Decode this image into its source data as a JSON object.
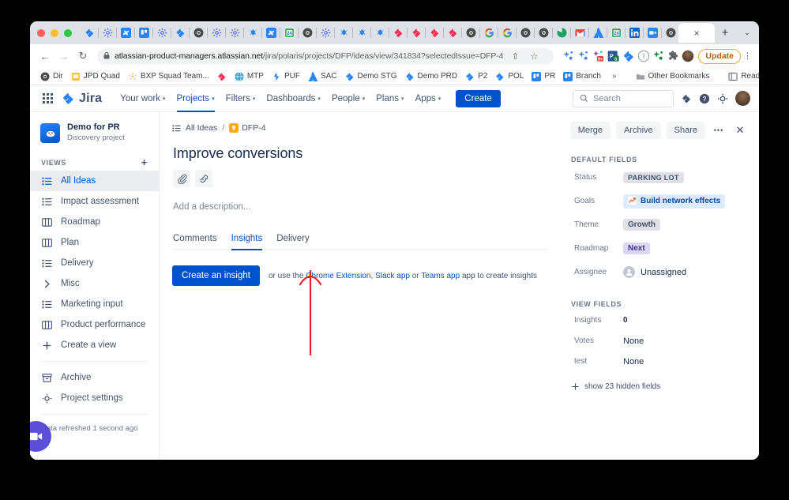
{
  "browser": {
    "tab_icons": [
      "jira-icon",
      "settings-icon",
      "confluence-icon",
      "trello-icon",
      "settings-icon",
      "jira-icon",
      "chrome-icon",
      "settings-icon",
      "settings-icon",
      "bitbucket-icon",
      "confluence-icon",
      "calendar-icon",
      "chrome-dark-icon",
      "settings-icon",
      "bitbucket-icon",
      "bitbucket-icon",
      "bitbucket-icon",
      "jira-red-icon",
      "jira-red-icon",
      "jira-red-icon",
      "jira-red-icon",
      "chrome-dark-icon",
      "google-icon",
      "google-icon",
      "chrome-dark-icon",
      "chrome-dark-icon",
      "chrome-green-icon",
      "gmail-icon",
      "atlassian-icon",
      "calendar-icon",
      "linkedin-icon",
      "loom-icon",
      "chrome-dark-icon"
    ],
    "active_tab_close_label": "×",
    "new_tab_label": "+",
    "tab_list_chevron": "⌄",
    "nav": {
      "back": "←",
      "forward": "→",
      "reload": "↻"
    },
    "url_host": "atlassian-product-managers.atlassian.net",
    "url_path": "/jira/polaris/projects/DFP/ideas/view/341834?selectedIssue=DFP-4",
    "lock_icon": "🔒",
    "share_icon": "⇧",
    "bookmark_star_icon": "☆",
    "extension_icons": [
      "sparkle-blue-icon",
      "sparkle-blue-icon",
      "sparkle-multicolor-icon",
      "powerpoint-icon",
      "jira-icon",
      "info-circle-icon",
      "sparkle-green-icon",
      "puzzle-icon"
    ],
    "update_label": "Update",
    "kebab_label": "⋮",
    "bookmarks": [
      {
        "label": "Dir",
        "icon": "chrome-icon"
      },
      {
        "label": "JPD Quad",
        "icon": "slides-icon"
      },
      {
        "label": "BXP Squad Team...",
        "icon": "dots-icon"
      },
      {
        "label": "",
        "icon": "jira-red-icon"
      },
      {
        "label": "MTP",
        "icon": "globe-icon"
      },
      {
        "label": "PUF",
        "icon": "bolt-icon"
      },
      {
        "label": "SAC",
        "icon": "atlassian-icon"
      },
      {
        "label": "Demo STG",
        "icon": "jira-icon"
      },
      {
        "label": "Demo PRD",
        "icon": "jira-icon"
      },
      {
        "label": "P2",
        "icon": "jira-icon"
      },
      {
        "label": "POL",
        "icon": "jira-icon"
      },
      {
        "label": "PR",
        "icon": "trello-icon"
      },
      {
        "label": "Branch",
        "icon": "trello-icon"
      }
    ],
    "bookmarks_overflow": "»",
    "other_bookmarks": "Other Bookmarks",
    "reading_list": "Reading List"
  },
  "jira_nav": {
    "app_switcher": "apps-grid-icon",
    "product_name": "Jira",
    "items": [
      {
        "label": "Your work",
        "has_chevron": true,
        "active": false
      },
      {
        "label": "Projects",
        "has_chevron": true,
        "active": true
      },
      {
        "label": "Filters",
        "has_chevron": true,
        "active": false
      },
      {
        "label": "Dashboards",
        "has_chevron": true,
        "active": false
      },
      {
        "label": "People",
        "has_chevron": true,
        "active": false
      },
      {
        "label": "Plans",
        "has_chevron": true,
        "active": false
      },
      {
        "label": "Apps",
        "has_chevron": true,
        "active": false
      }
    ],
    "create_label": "Create",
    "search_placeholder": "Search",
    "icons": [
      "notification-icon",
      "help-icon",
      "settings-gear-icon",
      "profile-avatar"
    ]
  },
  "sidebar": {
    "project_name": "Demo for PR",
    "project_type": "Discovery project",
    "section_label": "VIEWS",
    "add_view_label": "+",
    "items": [
      {
        "label": "All Ideas",
        "icon": "list-icon",
        "selected": true
      },
      {
        "label": "Impact assessment",
        "icon": "list-icon",
        "selected": false
      },
      {
        "label": "Roadmap",
        "icon": "board-icon",
        "selected": false
      },
      {
        "label": "Plan",
        "icon": "board-icon",
        "selected": false
      },
      {
        "label": "Delivery",
        "icon": "list-icon",
        "selected": false
      },
      {
        "label": "Misc",
        "icon": "chevron-right-icon",
        "selected": false
      },
      {
        "label": "Marketing input",
        "icon": "list-icon",
        "selected": false
      },
      {
        "label": "Product performance",
        "icon": "board-icon",
        "selected": false
      },
      {
        "label": "Create a view",
        "icon": "plus-icon",
        "selected": false
      }
    ],
    "footer_items": [
      {
        "label": "Archive",
        "icon": "archive-icon"
      },
      {
        "label": "Project settings",
        "icon": "gear-icon"
      }
    ],
    "refreshed_text": "Data refreshed 1 second ago",
    "video_button_icon": "video-camera-icon"
  },
  "main": {
    "breadcrumb_view": "All Ideas",
    "breadcrumb_separator": "/",
    "breadcrumb_key": "DFP-4",
    "idea_title": "Improve conversions",
    "attach_icon": "paperclip-icon",
    "link_icon": "link-icon",
    "description_placeholder": "Add a description...",
    "tabs": [
      {
        "label": "Comments",
        "active": false
      },
      {
        "label": "Insights",
        "active": true
      },
      {
        "label": "Delivery",
        "active": false
      }
    ],
    "create_insight_label": "Create an insight",
    "hint_prefix": "or use the ",
    "hint_link1": "Chrome Extension",
    "hint_comma": ", ",
    "hint_link2": "Slack app",
    "hint_or": " or ",
    "hint_link3": "Teams app",
    "hint_suffix": " app to create insights"
  },
  "right_panel": {
    "actions": [
      {
        "label": "Merge"
      },
      {
        "label": "Archive"
      },
      {
        "label": "Share"
      }
    ],
    "more_icon": "•••",
    "close_icon": "✕",
    "default_fields_label": "DEFAULT FIELDS",
    "fields": [
      {
        "label": "Status",
        "value": "PARKING LOT",
        "style": "status"
      },
      {
        "label": "Goals",
        "value": "Build network effects",
        "style": "goal",
        "icon": "chart-up-icon"
      },
      {
        "label": "Theme",
        "value": "Growth",
        "style": "theme"
      },
      {
        "label": "Roadmap",
        "value": "Next",
        "style": "roadmap"
      },
      {
        "label": "Assignee",
        "value": "Unassigned",
        "style": "assignee",
        "icon": "person-icon"
      }
    ],
    "view_fields_label": "VIEW FIELDS",
    "view_fields": [
      {
        "label": "Insights",
        "value": "0"
      },
      {
        "label": "Votes",
        "value": "None"
      },
      {
        "label": "test",
        "value": "None"
      }
    ],
    "show_hidden_label": "show 23 hidden fields",
    "show_hidden_icon": "plus-icon"
  },
  "annotation": {
    "type": "arrow-up",
    "color": "#f01a1a",
    "description": "red arrow pointing up at Chrome Extension link"
  },
  "colors": {
    "brand_blue": "#0052cc",
    "link_blue": "#0052cc",
    "chip_grey": "#dfe1e6",
    "chip_blue": "#deebff",
    "chip_purple": "#dcd6f7",
    "annotation_red": "#f01a1a",
    "video_purple": "#5a4fd6"
  }
}
